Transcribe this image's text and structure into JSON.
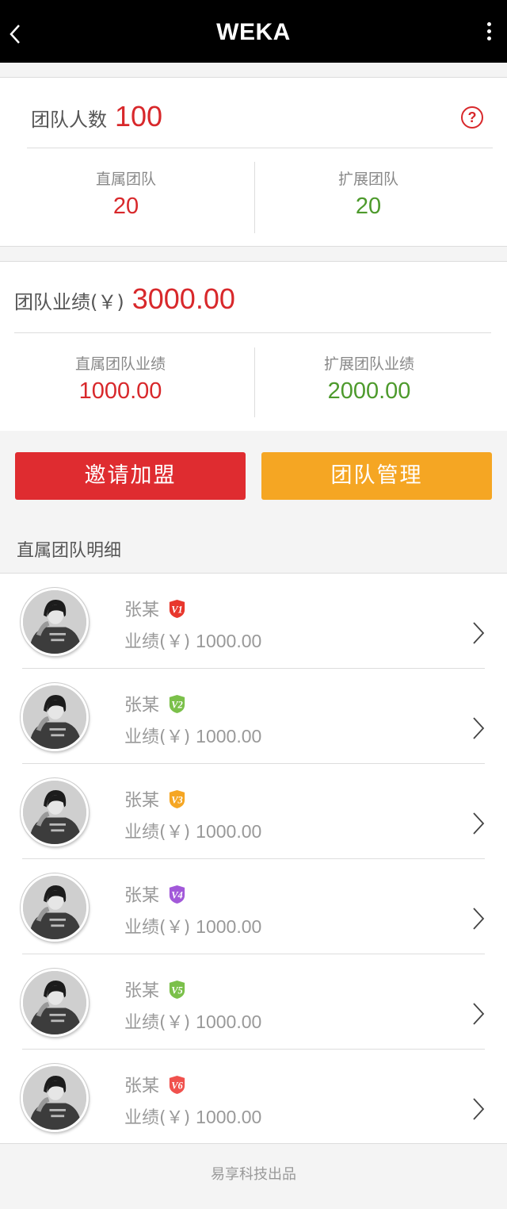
{
  "header": {
    "title": "WEKA",
    "back_icon": "back-chevron-icon",
    "more_icon": "more-vertical-icon"
  },
  "team_count": {
    "label": "团队人数",
    "value": "100",
    "help_icon": "question-circle-icon",
    "help_glyph": "?",
    "direct": {
      "label": "直属团队",
      "value": "20"
    },
    "extended": {
      "label": "扩展团队",
      "value": "20"
    }
  },
  "team_performance": {
    "label": "团队业绩(￥)",
    "value": "3000.00",
    "direct": {
      "label": "直属团队业绩",
      "value": "1000.00"
    },
    "extended": {
      "label": "扩展团队业绩",
      "value": "2000.00"
    }
  },
  "actions": {
    "invite_label": "邀请加盟",
    "manage_label": "团队管理"
  },
  "members_section": {
    "title": "直属团队明细"
  },
  "members": [
    {
      "name": "张某",
      "level": "V1",
      "level_color": "#e8372d",
      "perf_label": "业绩(￥)",
      "perf_value": "1000.00"
    },
    {
      "name": "张某",
      "level": "V2",
      "level_color": "#7bc04a",
      "perf_label": "业绩(￥)",
      "perf_value": "1000.00"
    },
    {
      "name": "张某",
      "level": "V3",
      "level_color": "#f5a623",
      "perf_label": "业绩(￥)",
      "perf_value": "1000.00"
    },
    {
      "name": "张某",
      "level": "V4",
      "level_color": "#a259d9",
      "perf_label": "业绩(￥)",
      "perf_value": "1000.00"
    },
    {
      "name": "张某",
      "level": "V5",
      "level_color": "#7bc04a",
      "perf_label": "业绩(￥)",
      "perf_value": "1000.00"
    },
    {
      "name": "张某",
      "level": "V6",
      "level_color": "#f0514d",
      "perf_label": "业绩(￥)",
      "perf_value": "1000.00"
    }
  ],
  "footer": {
    "text": "易享科技出品"
  },
  "colors": {
    "accent_red": "#d8282b",
    "accent_green": "#4d9a2c",
    "invite_bg": "#df2c30",
    "manage_bg": "#f5a623"
  }
}
